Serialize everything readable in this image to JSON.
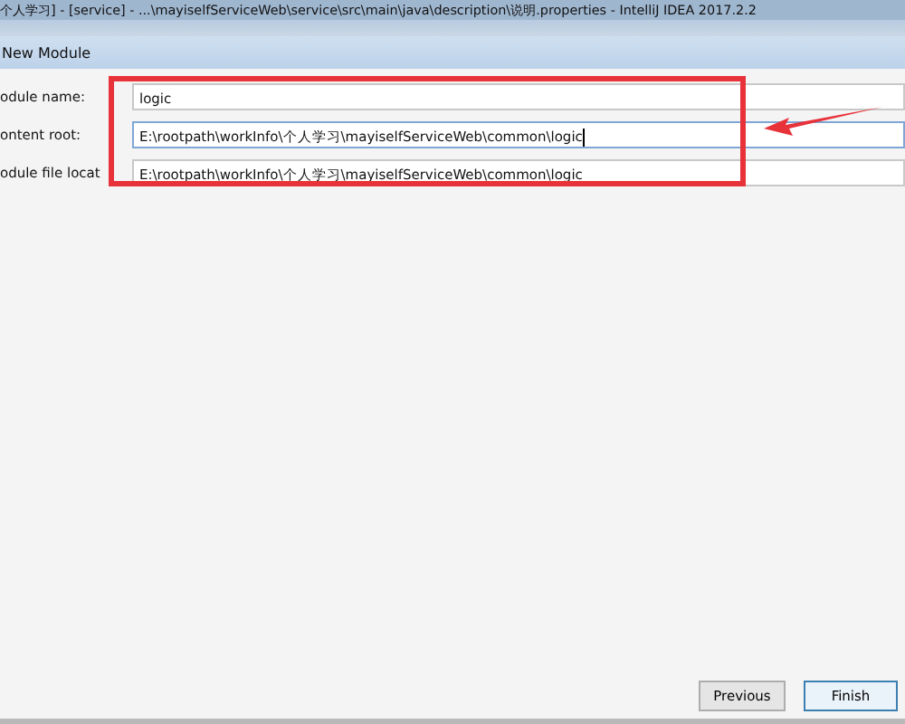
{
  "window": {
    "title": "个人学习] - [service] - ...\\mayiselfServiceWeb\\service\\src\\main\\java\\description\\说明.properties - IntelliJ IDEA 2017.2.2"
  },
  "dialog": {
    "title": "New Module",
    "fields": [
      {
        "label": "odule name:",
        "value": "logic",
        "focused": false
      },
      {
        "label": "ontent root:",
        "value": "E:\\rootpath\\workInfo\\个人学习\\mayiselfServiceWeb\\common\\logic",
        "focused": true
      },
      {
        "label": "odule file locat",
        "value": "E:\\rootpath\\workInfo\\个人学习\\mayiselfServiceWeb\\common\\logic",
        "focused": false
      }
    ],
    "buttons": [
      {
        "label": "Previous",
        "default": false
      },
      {
        "label": "Finish",
        "default": true
      }
    ]
  }
}
